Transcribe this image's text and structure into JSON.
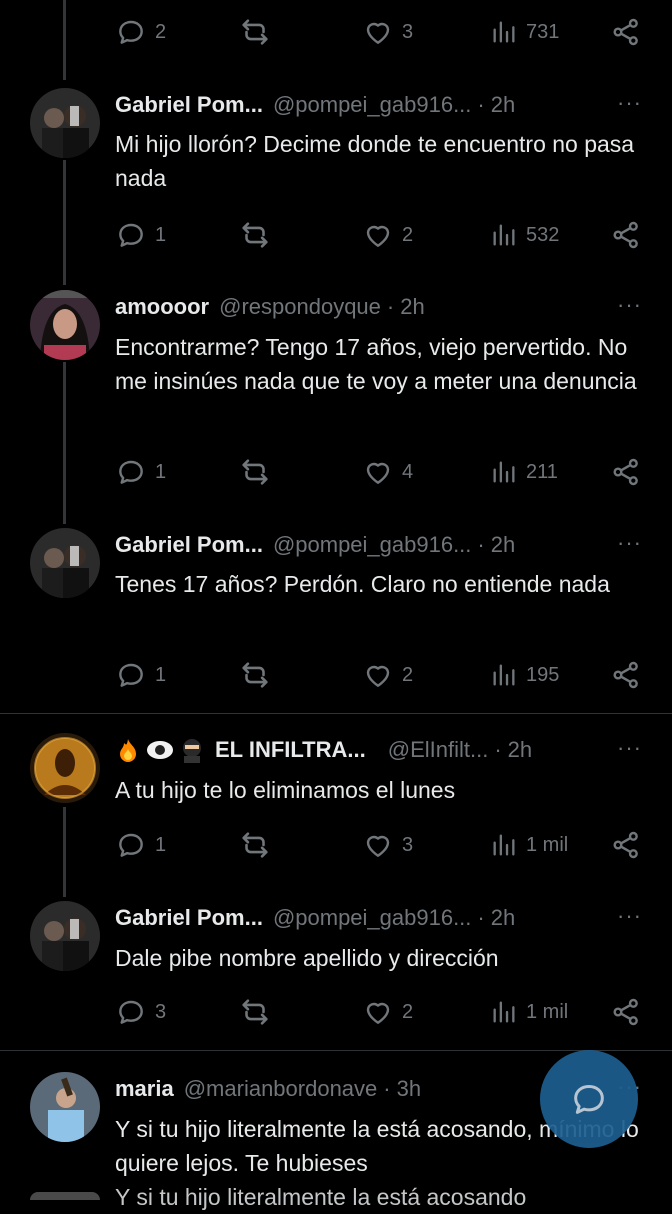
{
  "top_actions": {
    "replies": "2",
    "reposts": "",
    "likes": "3",
    "views": "731"
  },
  "tweets": [
    {
      "name": "Gabriel Pom...",
      "handle": "@pompei_gab916...",
      "time": "2h",
      "text": "Mi hijo llorón? Decime donde te encuentro no pasa nada",
      "replies": "1",
      "likes": "2",
      "views": "532"
    },
    {
      "name": "amoooor",
      "handle": "@respondoyque",
      "time": "2h",
      "text": "Encontrarme? Tengo 17 años, viejo pervertido. No me insinúes nada que te voy a meter una denuncia",
      "replies": "1",
      "likes": "4",
      "views": "211"
    },
    {
      "name": "Gabriel Pom...",
      "handle": "@pompei_gab916...",
      "time": "2h",
      "text": "Tenes 17 años? Perdón. Claro no entiende nada",
      "replies": "1",
      "likes": "2",
      "views": "195"
    },
    {
      "name": "EL INFILTRA...",
      "handle": "@ElInfilt...",
      "time": "2h",
      "text": "A tu hijo te lo eliminamos el lunes",
      "replies": "1",
      "likes": "3",
      "views": "1 mil",
      "emoji": [
        "fire",
        "eye",
        "ninja"
      ]
    },
    {
      "name": "Gabriel Pom...",
      "handle": "@pompei_gab916...",
      "time": "2h",
      "text": "Dale pibe nombre apellido y dirección",
      "replies": "3",
      "likes": "2",
      "views": "1 mil"
    },
    {
      "name": "maria",
      "handle": "@marianbordonave",
      "time": "3h",
      "text": "Y si tu hijo literalmente la está acosando, mínimo lo quiere lejos. Te hubieses",
      "text_cut": "Y si tu hijo literalmente la está acosando"
    }
  ],
  "more_label": "···",
  "dot": "·",
  "icons": [
    "reply-icon",
    "repost-icon",
    "like-icon",
    "views-icon",
    "share-icon",
    "more-icon",
    "compose-reply-icon"
  ],
  "colors": {
    "background": "#000000",
    "text": "#e7e9ea",
    "muted": "#71767b",
    "divider": "#2f3336",
    "fab": "#1d5f91"
  }
}
